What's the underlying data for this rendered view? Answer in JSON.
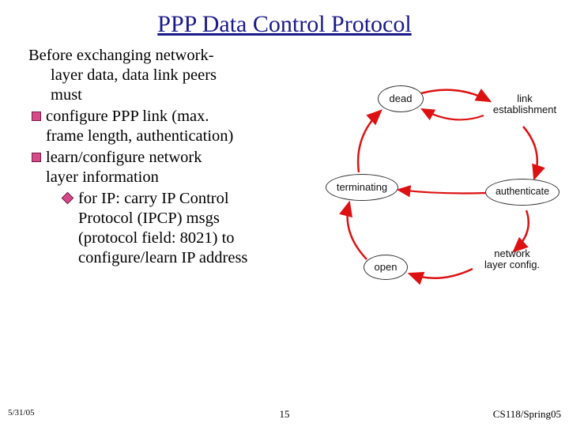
{
  "title": "PPP Data Control Protocol",
  "intro_l1": "Before exchanging network-",
  "intro_l2": "layer data, data link peers",
  "intro_l3": "must",
  "b1_l1": "configure PPP link (max.",
  "b1_l2": "frame length, authentication)",
  "b2_l1": "learn/configure network",
  "b2_l2": "layer information",
  "sub_l1": "for IP: carry IP Control",
  "sub_l2": "Protocol (IPCP) msgs",
  "sub_l3": "(protocol field: 8021) to",
  "sub_l4": "configure/learn IP address",
  "diagram": {
    "dead": "dead",
    "link_est_l1": "link",
    "link_est_l2": "establishment",
    "terminating": "terminating",
    "authenticate": "authenticate",
    "open": "open",
    "net_l1": "network",
    "net_l2": "layer  config.",
    "fail_top": "",
    "fail_mid": ""
  },
  "footer": {
    "date": "5/31/05",
    "page": "15",
    "course": "CS118/Spring05"
  }
}
